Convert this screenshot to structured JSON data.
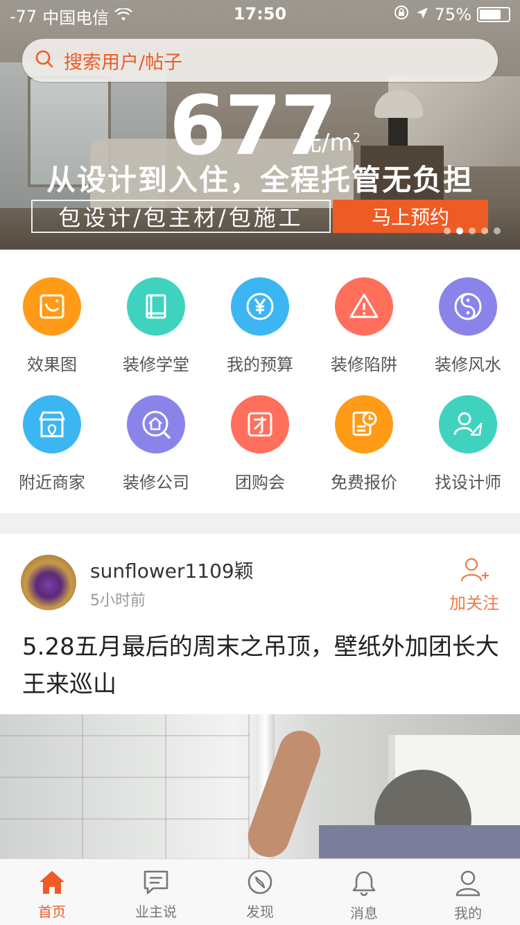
{
  "status_bar": {
    "signal": "-77",
    "carrier": "中国电信",
    "time": "17:50",
    "battery": "75%",
    "battery_level": 0.75
  },
  "search": {
    "placeholder": "搜索用户/帖子"
  },
  "banner": {
    "price": "677",
    "unit": "元/m",
    "unit_sup": "2",
    "slogan": "从设计到入住，全程托管无负担",
    "features": "包设计/包主材/包施工",
    "cta": "马上预约",
    "slide_count": 5,
    "active_slide": 2
  },
  "grid": [
    {
      "label": "效果图",
      "icon": "image-frame-icon",
      "color": "#ff9b16"
    },
    {
      "label": "装修学堂",
      "icon": "book-icon",
      "color": "#3fd3bf"
    },
    {
      "label": "我的预算",
      "icon": "yen-icon",
      "color": "#3bb6f3"
    },
    {
      "label": "装修陷阱",
      "icon": "warning-icon",
      "color": "#ff6f5c"
    },
    {
      "label": "装修风水",
      "icon": "yin-yang-icon",
      "color": "#8a84ea"
    },
    {
      "label": "附近商家",
      "icon": "shop-icon",
      "color": "#3bb6f3"
    },
    {
      "label": "装修公司",
      "icon": "house-search-icon",
      "color": "#8a84ea"
    },
    {
      "label": "团购会",
      "icon": "group-buy-icon",
      "color": "#ff6f5c"
    },
    {
      "label": "免费报价",
      "icon": "quote-clock-icon",
      "color": "#ff9b16"
    },
    {
      "label": "找设计师",
      "icon": "designer-icon",
      "color": "#3fd3bf"
    }
  ],
  "post": {
    "username": "sunflower1109颖",
    "time": "5小时前",
    "follow": "加关注",
    "title": "5.28五月最后的周末之吊顶，壁纸外加团长大王来巡山"
  },
  "tabbar": [
    {
      "label": "首页",
      "icon": "home-icon",
      "active": true
    },
    {
      "label": "业主说",
      "icon": "chat-icon",
      "active": false
    },
    {
      "label": "发现",
      "icon": "compass-icon",
      "active": false
    },
    {
      "label": "消息",
      "icon": "bell-icon",
      "active": false
    },
    {
      "label": "我的",
      "icon": "user-icon",
      "active": false
    }
  ],
  "colors": {
    "accent": "#ef5b25",
    "divider": "#eef0f2"
  }
}
